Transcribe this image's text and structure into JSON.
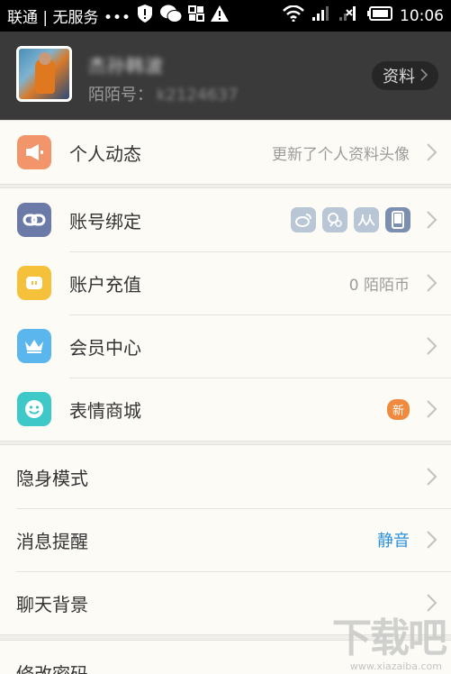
{
  "status_bar": {
    "carrier": "联通 | 无服务 •••",
    "time": "10:06"
  },
  "profile": {
    "name": "杰孙韩波",
    "id_label": "陌陌号：",
    "id_value": "k2124637",
    "button_label": "资料"
  },
  "menu_group1": {
    "items": [
      {
        "label": "个人动态",
        "value": "更新了个人资料头像"
      }
    ]
  },
  "menu_group2": {
    "items": [
      {
        "label": "账号绑定",
        "value": ""
      },
      {
        "label": "账户充值",
        "value": "0 陌陌币"
      },
      {
        "label": "会员中心",
        "value": ""
      },
      {
        "label": "表情商城",
        "value": "",
        "badge": "新"
      }
    ]
  },
  "menu_group3": {
    "items": [
      {
        "label": "隐身模式",
        "value": ""
      },
      {
        "label": "消息提醒",
        "value": "静音"
      },
      {
        "label": "聊天背景",
        "value": ""
      }
    ]
  },
  "menu_group4": {
    "items": [
      {
        "label": "修改密码",
        "value": ""
      }
    ]
  },
  "watermark": {
    "text": "下载吧",
    "url": "www.xiazaiba.com"
  },
  "colors": {
    "dynamic_icon": "#f2956a",
    "bind_icon": "#6c7aa8",
    "recharge_icon": "#f5c03a",
    "vip_icon": "#5bb6ee",
    "emoji_icon": "#3ec9c8",
    "accent_blue": "#2b90d9"
  }
}
